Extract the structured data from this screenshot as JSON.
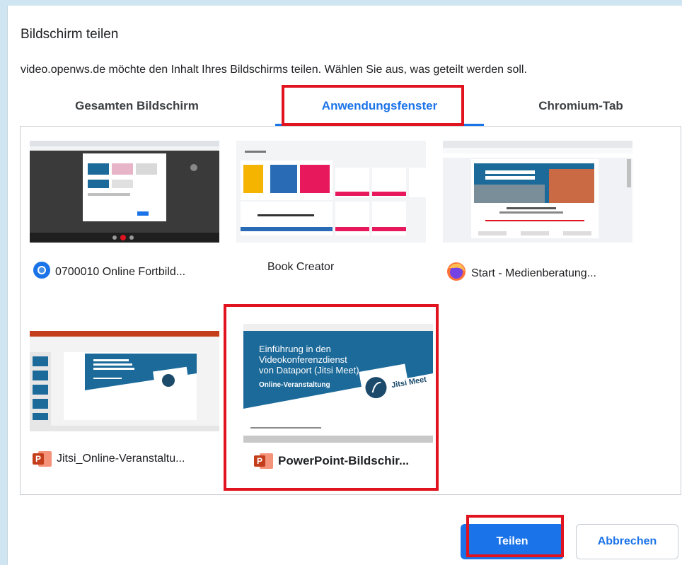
{
  "dialog": {
    "title": "Bildschirm teilen",
    "description": "video.openws.de möchte den Inhalt Ihres Bildschirms teilen. Wählen Sie aus, was geteilt werden soll."
  },
  "tabs": [
    {
      "label": "Gesamten Bildschirm",
      "active": false
    },
    {
      "label": "Anwendungsfenster",
      "active": true
    },
    {
      "label": "Chromium-Tab",
      "active": false
    }
  ],
  "windows": [
    {
      "label": "0700010 Online Fortbild...",
      "icon": "chromium-icon"
    },
    {
      "label": "Book Creator",
      "icon": "none"
    },
    {
      "label": "Start - Medienberatung...",
      "icon": "firefox-icon"
    },
    {
      "label": "Jitsi_Online-Veranstaltu...",
      "icon": "powerpoint-icon"
    },
    {
      "label": "PowerPoint-Bildschir...",
      "icon": "powerpoint-icon",
      "selected": true
    }
  ],
  "slide_preview": {
    "title_lines": [
      "Einführung in den",
      "Videokonferenzdienst",
      "von Dataport (Jitsi Meet)"
    ],
    "subtitle": "Online-Veranstaltung",
    "logo_text": "Jitsi Meet"
  },
  "buttons": {
    "share": "Teilen",
    "cancel": "Abbrechen"
  },
  "colors": {
    "accent": "#1a73e8",
    "highlight": "#e0131e",
    "slide_blue": "#1c6a9a"
  }
}
